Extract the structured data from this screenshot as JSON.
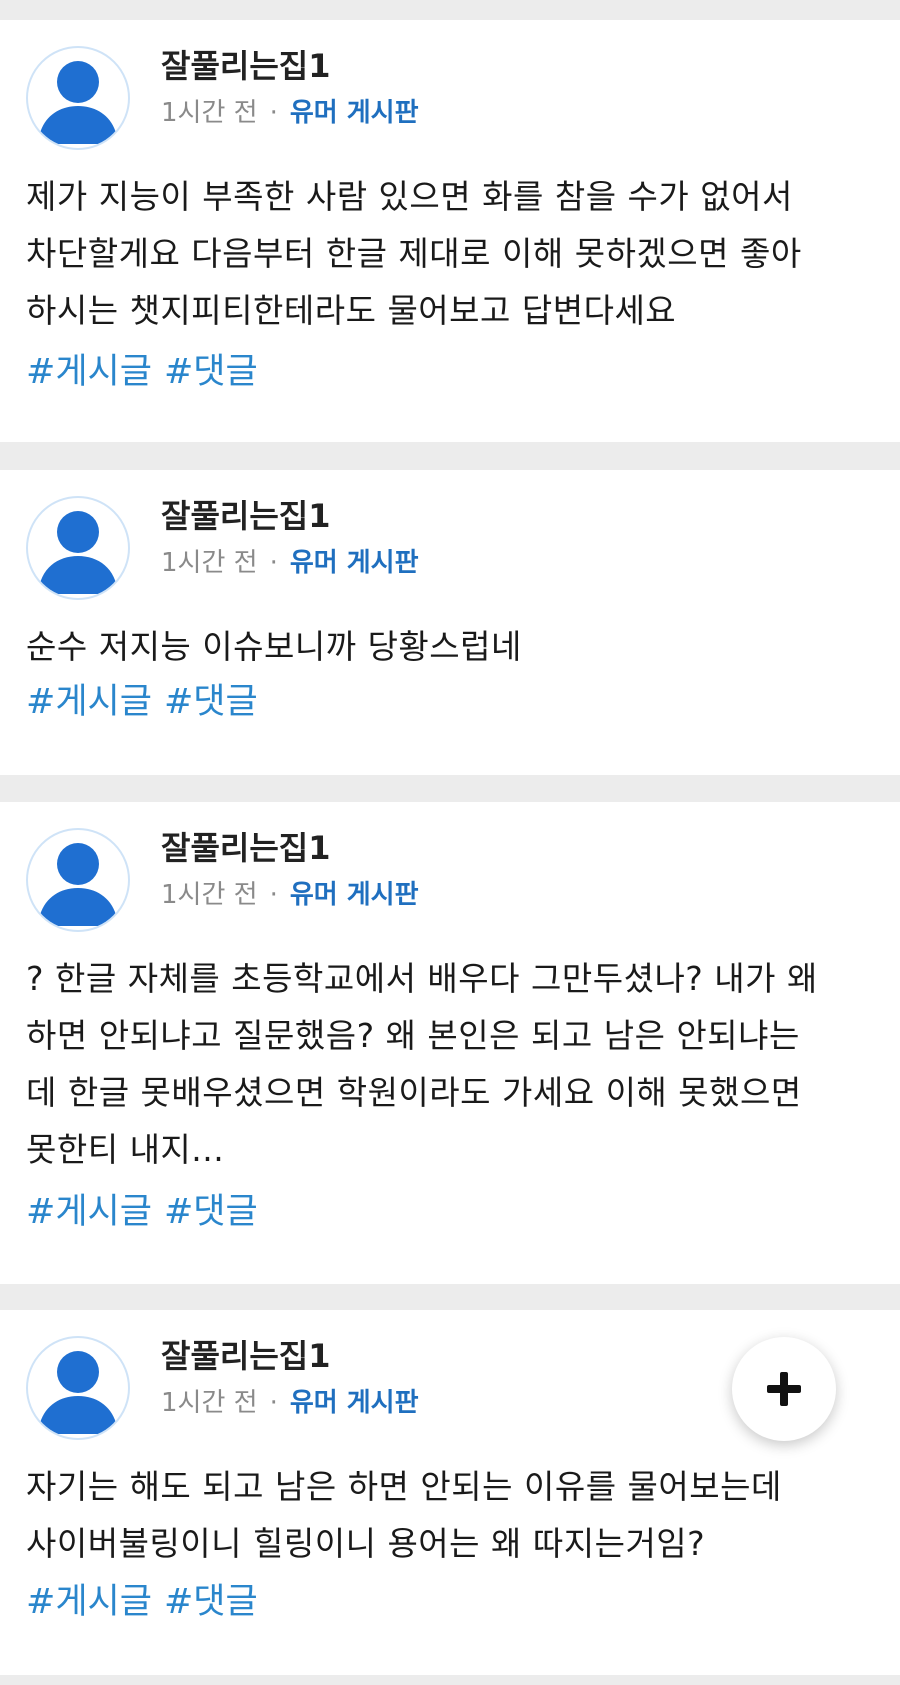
{
  "posts": [
    {
      "author": "잘풀리는집1",
      "time": "1시간 전",
      "separator": "·",
      "board": "유머 게시판",
      "lines": [
        "제가 지능이 부족한 사람 있으면 화를 참을 수가 없어서",
        "차단할게요 다음부터 한글 제대로 이해 못하겠으면 좋아",
        "하시는 챗지피티한테라도 물어보고 답변다세요"
      ],
      "tags": [
        "#게시글",
        "#댓글"
      ]
    },
    {
      "author": "잘풀리는집1",
      "time": "1시간 전",
      "separator": "·",
      "board": "유머 게시판",
      "lines": [
        "순수 저지능 이슈보니까 당황스럽네"
      ],
      "tags": [
        "#게시글",
        "#댓글"
      ]
    },
    {
      "author": "잘풀리는집1",
      "time": "1시간 전",
      "separator": "·",
      "board": "유머 게시판",
      "lines": [
        "? 한글 자체를 초등학교에서 배우다 그만두셨나? 내가 왜",
        "하면 안되냐고 질문했음? 왜 본인은 되고 남은 안되냐는",
        "데 한글 못배우셨으면 학원이라도 가세요 이해 못했으면",
        "못한티 내지..."
      ],
      "tags": [
        "#게시글",
        "#댓글"
      ]
    },
    {
      "author": "잘풀리는집1",
      "time": "1시간 전",
      "separator": "·",
      "board": "유머 게시판",
      "lines": [
        "자기는 해도 되고 남은 하면 안되는 이유를 물어보는데",
        "사이버불링이니 힐링이니 용어는 왜 따지는거임?"
      ],
      "tags": [
        "#게시글",
        "#댓글"
      ]
    }
  ],
  "icons": {
    "avatar": "user-avatar-icon",
    "fab": "plus-icon"
  },
  "colors": {
    "avatar": "#1f6fd1",
    "board": "#1f6fbf",
    "tag": "#2a86cc",
    "background": "#ececec"
  }
}
